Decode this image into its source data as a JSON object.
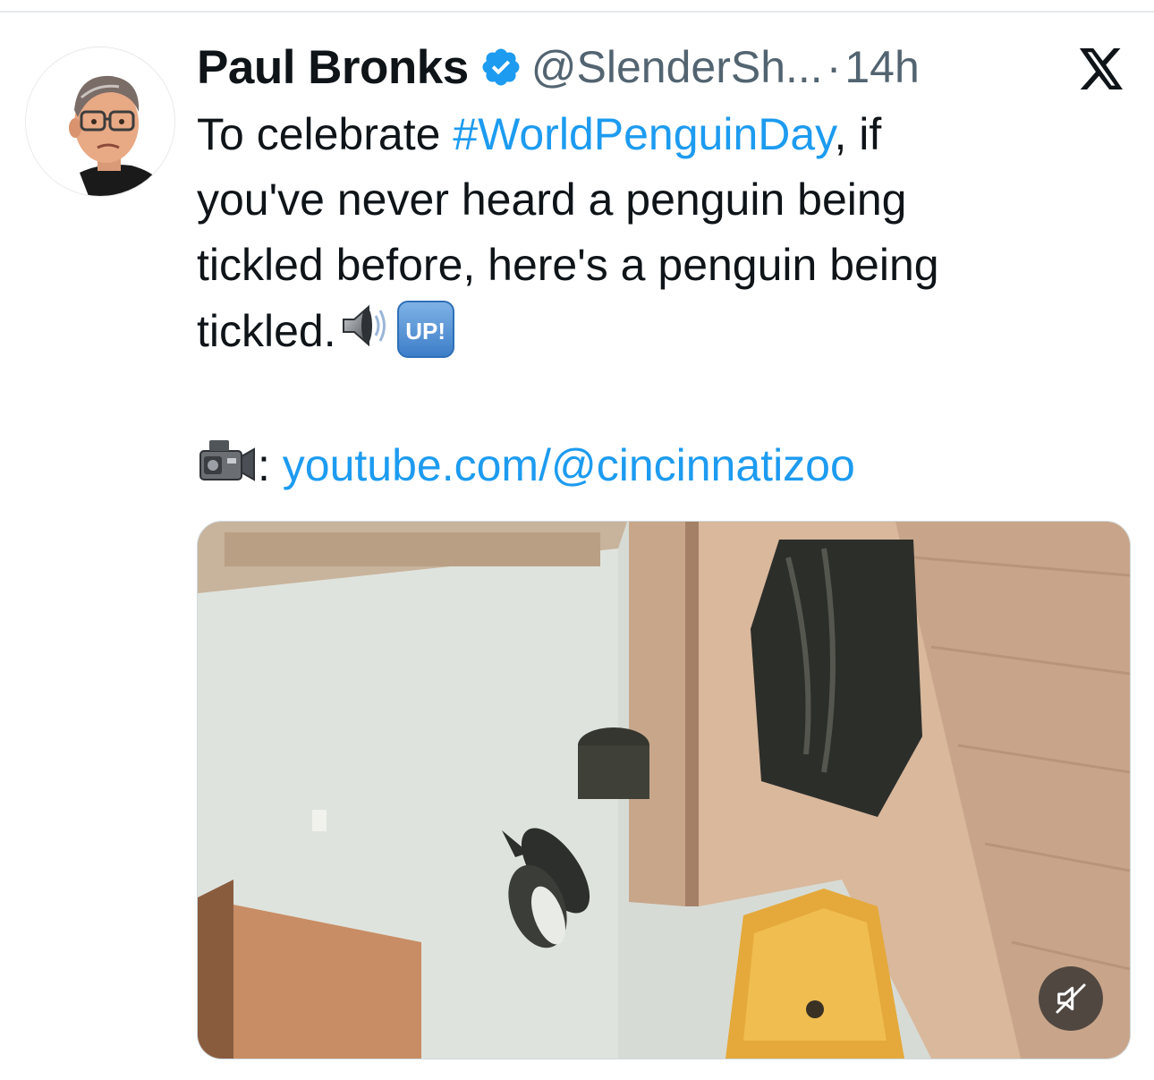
{
  "tweet": {
    "author": {
      "display_name": "Paul Bronks",
      "handle": "@SlenderSh...",
      "verified": true
    },
    "separator": "·",
    "time": "14h",
    "text": {
      "line1_prefix": "To celebrate ",
      "hashtag": "#WorldPenguinDay",
      "line1_suffix": ", if",
      "line2": "you've never heard a penguin being",
      "line3": "tickled before, here's a penguin being",
      "line4": "tickled.",
      "up_emoji_label": "UP!",
      "link_prefix": ": ",
      "link": "youtube.com/@cincinnatizoo"
    },
    "media": {
      "type": "video",
      "muted": true
    }
  },
  "icons": {
    "verified": "verified-badge-icon",
    "platform": "x-logo-icon",
    "speaker": "speaker-emoji-icon",
    "camera": "video-camera-emoji-icon",
    "mute": "muted-speaker-icon"
  },
  "colors": {
    "link": "#1d9bf0",
    "text": "#0f1419",
    "secondary": "#536471"
  }
}
